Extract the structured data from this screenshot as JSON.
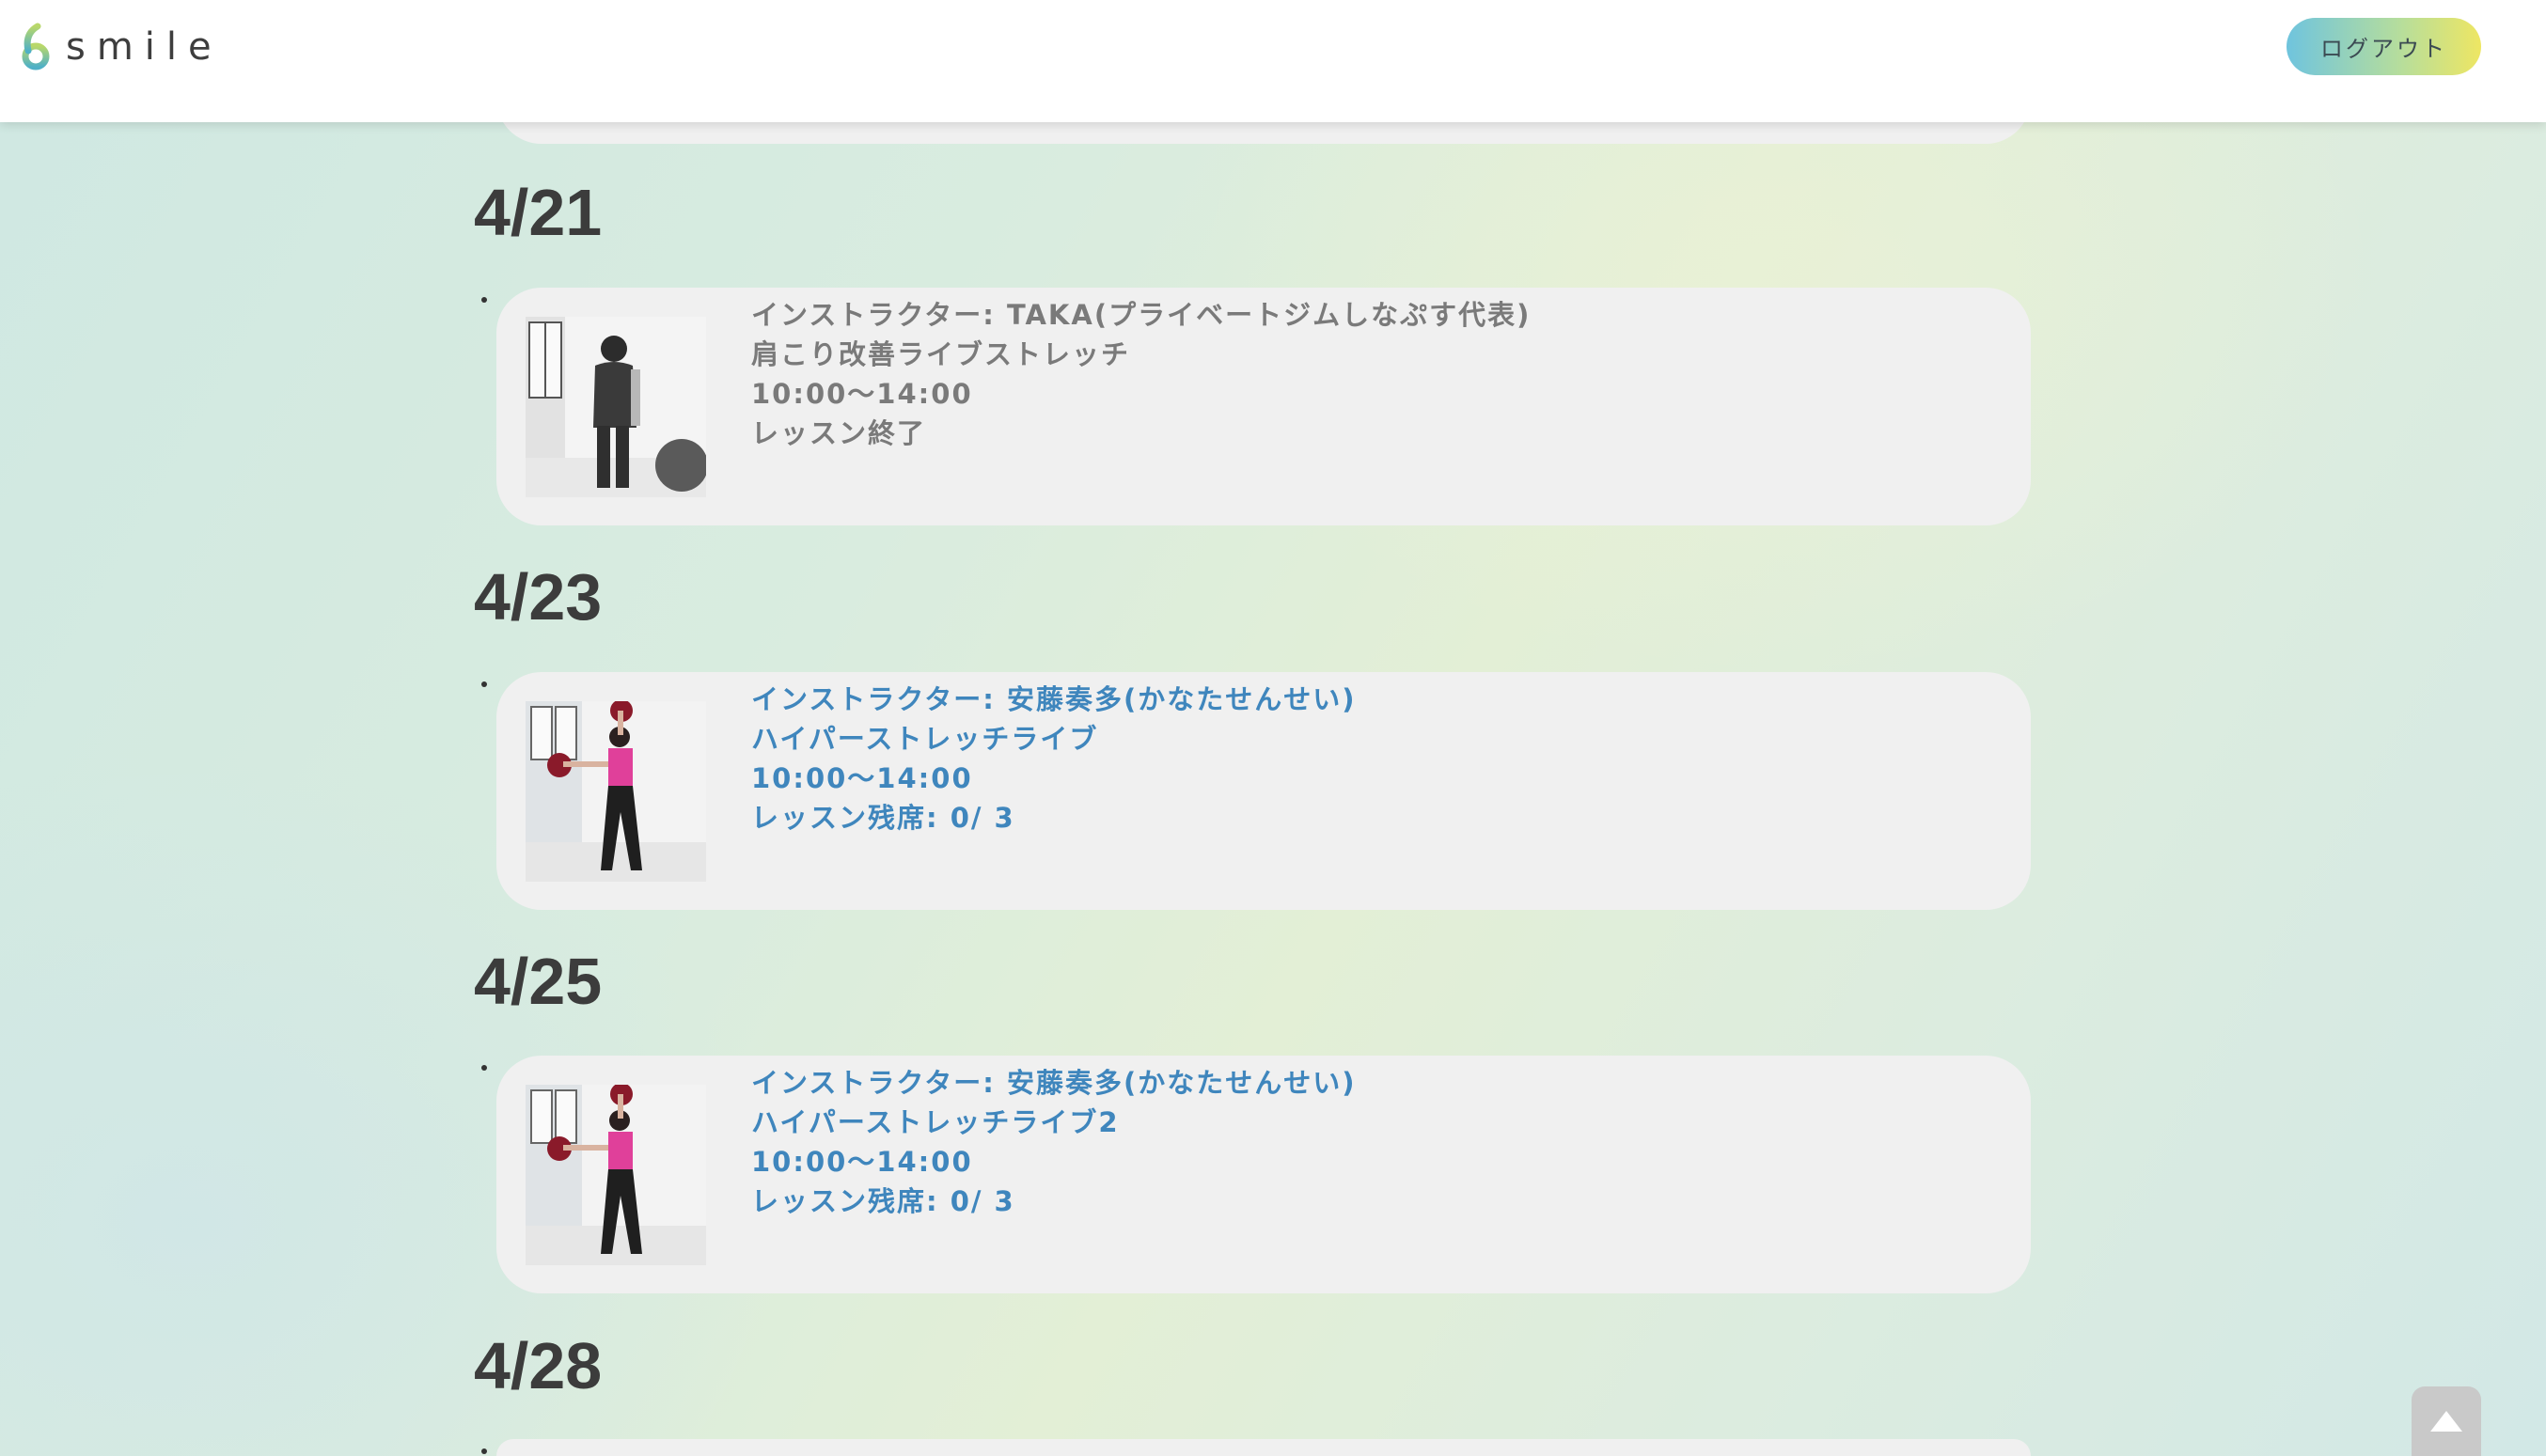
{
  "header": {
    "logo_text": "smile",
    "logout_label": "ログアウト"
  },
  "days": [
    {
      "date": "4/21",
      "lesson": {
        "instructor": "インストラクター: TAKA(プライベートジムしなぷす代表)",
        "title": "肩こり改善ライブストレッチ",
        "time": "10:00〜14:00",
        "status": "レッスン終了"
      }
    },
    {
      "date": "4/23",
      "lesson": {
        "instructor": "インストラクター: 安藤奏多(かなたせんせい)",
        "title": "ハイパーストレッチライブ",
        "time": "10:00〜14:00",
        "status": "レッスン残席: 0/ 3"
      }
    },
    {
      "date": "4/25",
      "lesson": {
        "instructor": "インストラクター: 安藤奏多(かなたせんせい)",
        "title": "ハイパーストレッチライブ2",
        "time": "10:00〜14:00",
        "status": "レッスン残席: 0/ 3"
      }
    },
    {
      "date": "4/28"
    }
  ],
  "colors": {
    "ended_text": "#7a7a7a",
    "open_text": "#3f86bd",
    "card_bg": "#f0f0f0"
  },
  "icons": {
    "logo_mark": "smile-logo-icon",
    "scroll_top": "triangle-up-icon"
  }
}
